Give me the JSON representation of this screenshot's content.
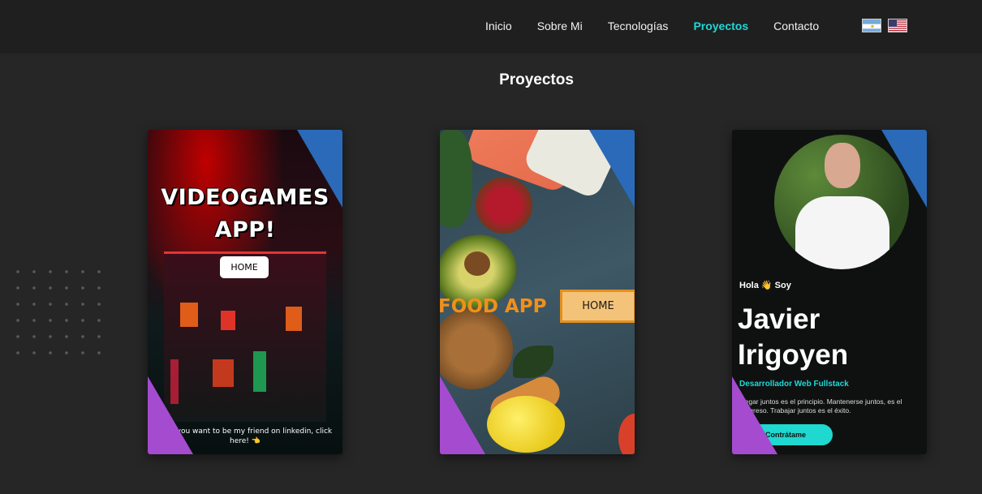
{
  "nav": {
    "links": [
      "Inicio",
      "Sobre Mi",
      "Tecnologías",
      "Proyectos",
      "Contacto"
    ],
    "active": "Proyectos",
    "flags": [
      "argentina-flag-icon",
      "usa-flag-icon"
    ]
  },
  "section": {
    "title": "Proyectos"
  },
  "cards": {
    "videogames": {
      "title_line1": "VIDEOGAMES",
      "title_line2": "APP!",
      "button": "HOME",
      "footer": "👈 If you want to be my friend on linkedin, click here! 👈"
    },
    "food": {
      "title": "FOOD APP",
      "button": "HOME"
    },
    "portfolio": {
      "greeting": "Hola 👋 Soy",
      "name_line1": "Javier",
      "name_line2": "Irigoyen",
      "role": "Desarrollador Web Fullstack",
      "description": "Llegar juntos es el principio. Mantenerse juntos, es el progreso. Trabajar juntos es el éxito.",
      "button": "Contrátame"
    }
  },
  "colors": {
    "accent": "#1fd8d8",
    "background": "#262626",
    "corner_blue": "#2a6ab8",
    "corner_purple": "#a54bd0"
  }
}
